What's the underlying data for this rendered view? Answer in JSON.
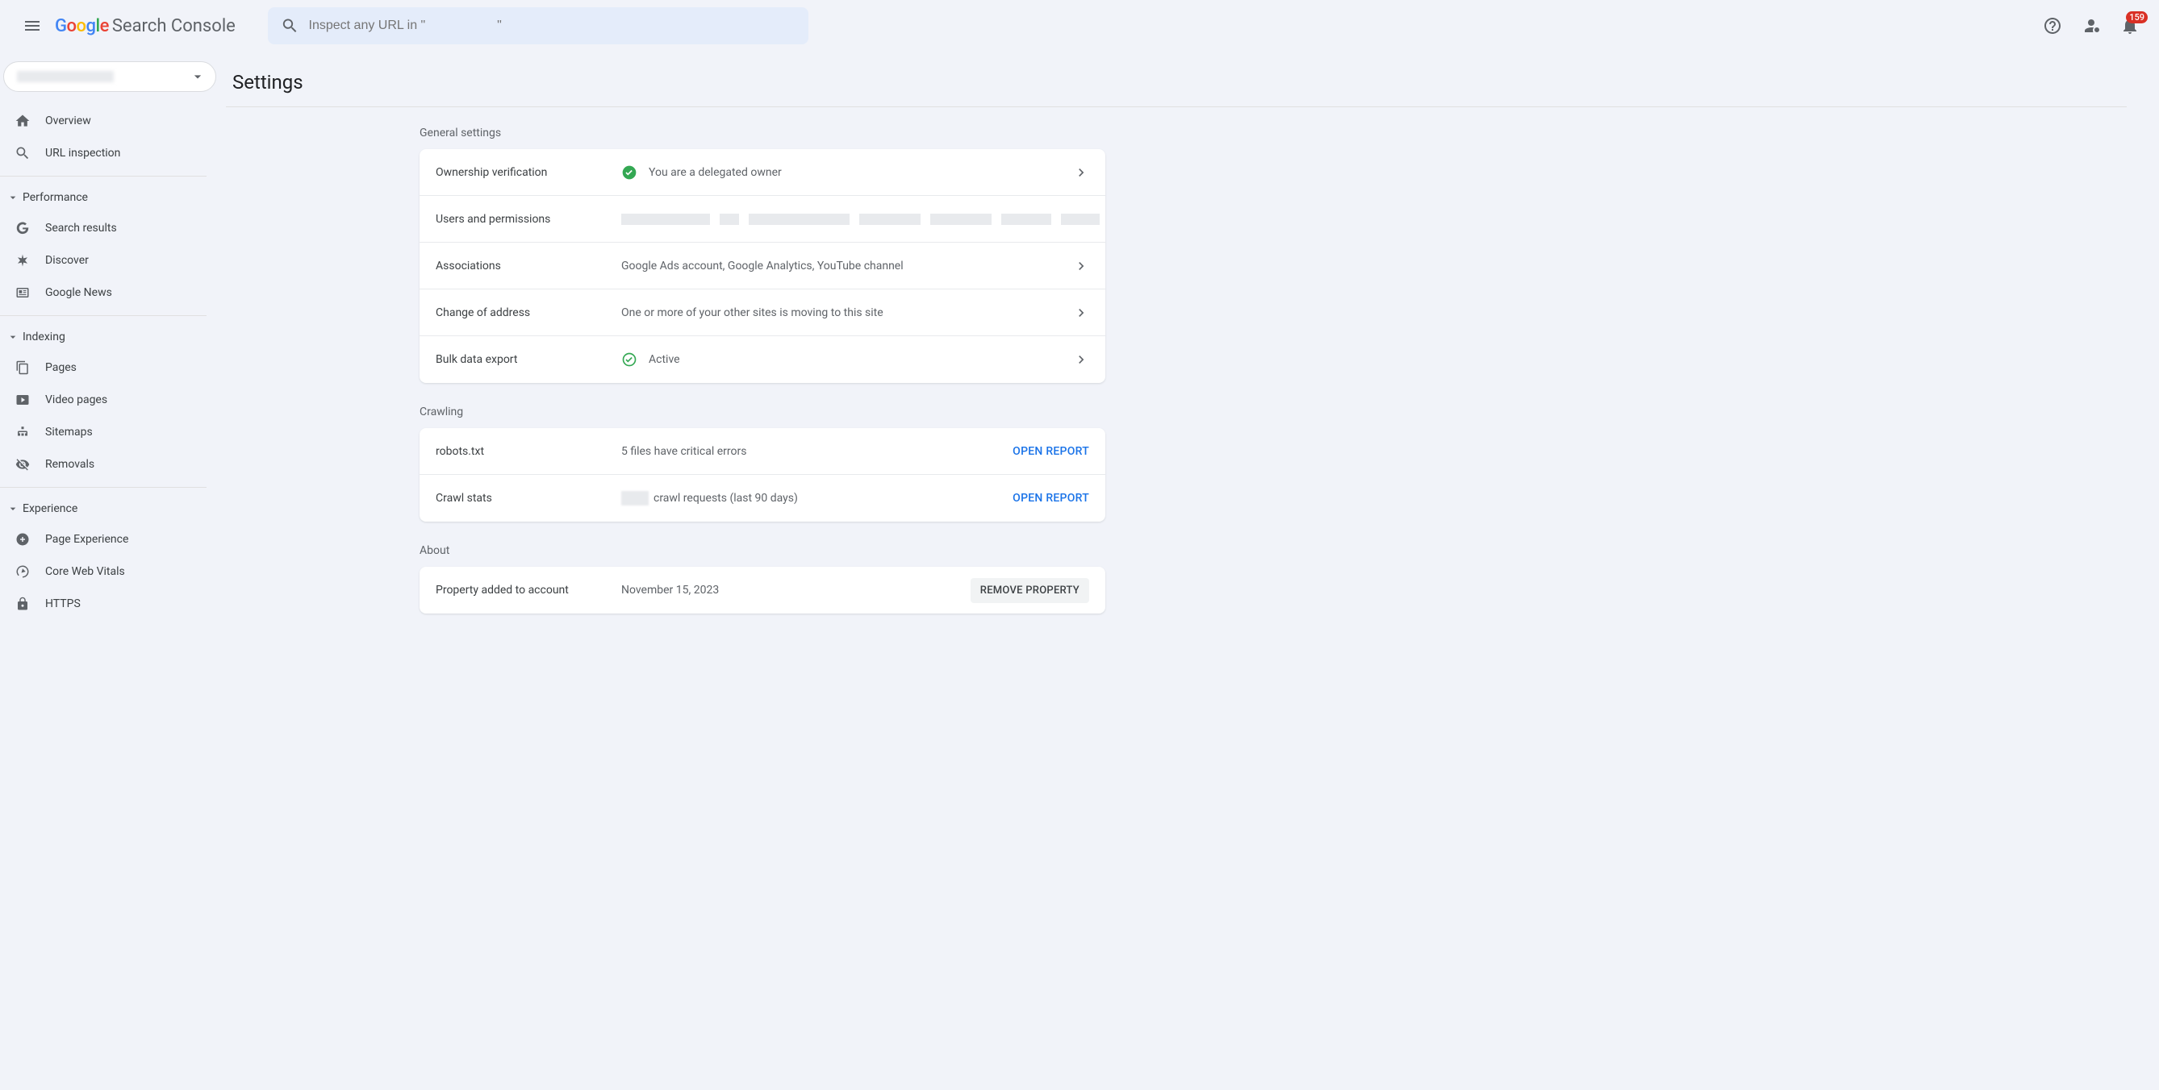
{
  "header": {
    "logo_text": "Search Console",
    "search_placeholder": "Inspect any URL in \"                    \"",
    "notification_count": "159"
  },
  "sidebar": {
    "items_top": [
      {
        "label": "Overview"
      },
      {
        "label": "URL inspection"
      }
    ],
    "sections": [
      {
        "label": "Performance",
        "items": [
          {
            "label": "Search results"
          },
          {
            "label": "Discover"
          },
          {
            "label": "Google News"
          }
        ]
      },
      {
        "label": "Indexing",
        "items": [
          {
            "label": "Pages"
          },
          {
            "label": "Video pages"
          },
          {
            "label": "Sitemaps"
          },
          {
            "label": "Removals"
          }
        ]
      },
      {
        "label": "Experience",
        "items": [
          {
            "label": "Page Experience"
          },
          {
            "label": "Core Web Vitals"
          },
          {
            "label": "HTTPS"
          }
        ]
      }
    ]
  },
  "main": {
    "title": "Settings",
    "sections": {
      "general": {
        "label": "General settings",
        "rows": {
          "ownership": {
            "label": "Ownership verification",
            "desc": "You are a delegated owner"
          },
          "users": {
            "label": "Users and permissions"
          },
          "associations": {
            "label": "Associations",
            "desc": "Google Ads account, Google Analytics, YouTube channel"
          },
          "address": {
            "label": "Change of address",
            "desc": "One or more of your other sites is moving to this site"
          },
          "bulk": {
            "label": "Bulk data export",
            "desc": "Active"
          }
        }
      },
      "crawling": {
        "label": "Crawling",
        "rows": {
          "robots": {
            "label": "robots.txt",
            "desc": "5 files have critical errors",
            "action": "OPEN REPORT"
          },
          "stats": {
            "label": "Crawl stats",
            "desc_suffix": " crawl requests (last 90 days)",
            "action": "OPEN REPORT"
          }
        }
      },
      "about": {
        "label": "About",
        "rows": {
          "added": {
            "label": "Property added to account",
            "desc": "November 15, 2023",
            "action": "REMOVE PROPERTY"
          }
        }
      }
    }
  }
}
